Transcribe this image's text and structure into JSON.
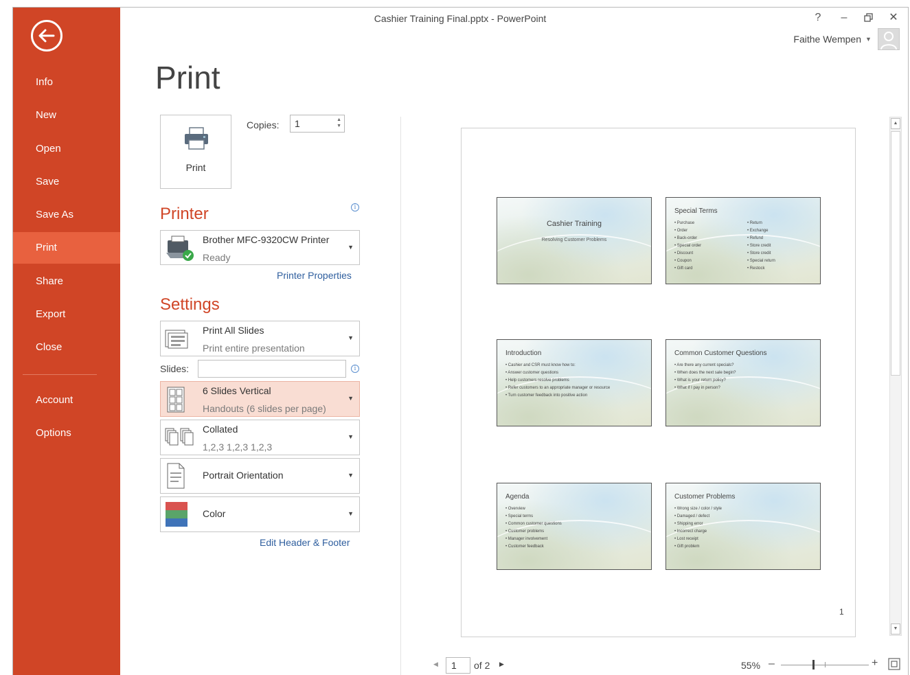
{
  "window": {
    "title": "Cashier Training Final.pptx - PowerPoint",
    "help_label": "?",
    "minimize_label": "–",
    "restore_label": "🗗",
    "close_label": "✕",
    "user_name": "Faithe Wempen"
  },
  "sidebar": {
    "back_icon": "back-arrow-icon",
    "items": [
      {
        "label": "Info"
      },
      {
        "label": "New"
      },
      {
        "label": "Open"
      },
      {
        "label": "Save"
      },
      {
        "label": "Save As"
      },
      {
        "label": "Print",
        "active": true
      },
      {
        "label": "Share"
      },
      {
        "label": "Export"
      },
      {
        "label": "Close"
      },
      {
        "label": "Account"
      },
      {
        "label": "Options"
      }
    ],
    "colors": {
      "background": "#d04526",
      "active": "#e8613f"
    }
  },
  "print_panel": {
    "page_title": "Print",
    "print_button_label": "Print",
    "copies_label": "Copies:",
    "copies_value": "1",
    "printer_heading": "Printer",
    "printer": {
      "name": "Brother MFC-9320CW Printer",
      "status": "Ready"
    },
    "printer_properties_link": "Printer Properties",
    "settings_heading": "Settings",
    "settings": {
      "slides_range": {
        "title": "Print All Slides",
        "subtitle": "Print entire presentation"
      },
      "slides_label": "Slides:",
      "slides_value": "",
      "layout": {
        "title": "6 Slides Vertical",
        "subtitle": "Handouts (6 slides per page)"
      },
      "collation": {
        "title": "Collated",
        "subtitle": "1,2,3   1,2,3   1,2,3"
      },
      "orientation": {
        "title": "Portrait Orientation"
      },
      "color": {
        "title": "Color"
      }
    },
    "edit_header_footer_link": "Edit Header & Footer",
    "accent_color": "#d04526"
  },
  "preview": {
    "page_number": "1",
    "slides": [
      {
        "title": "Cashier Training",
        "subtitle": "Resolving Customer Problems",
        "type": "title"
      },
      {
        "title": "Special Terms",
        "bullets_left": [
          "Purchase",
          "Order",
          "Back-order",
          "Special order",
          "Discount",
          "Coupon",
          "Gift card"
        ],
        "bullets_right": [
          "Return",
          "Exchange",
          "Refund",
          "Store credit",
          "Store credit",
          "Special return",
          "Restock"
        ]
      },
      {
        "title": "Introduction",
        "bullets": [
          "Cashier and CSR must know how to:",
          "Answer customer questions",
          "Help customers resolve problems",
          "Refer customers to an appropriate manager or resource",
          "Turn customer feedback into positive action"
        ]
      },
      {
        "title": "Common Customer Questions",
        "bullets": [
          "Are there any current specials?",
          "When does the next sale begin?",
          "What is your return policy?",
          "What if I pay in person?"
        ]
      },
      {
        "title": "Agenda",
        "bullets": [
          "Overview",
          "Special terms",
          "Common customer questions",
          "Customer problems",
          "Manager involvement",
          "Customer feedback"
        ]
      },
      {
        "title": "Customer Problems",
        "bullets": [
          "Wrong size / color / style",
          "Damaged / defect",
          "Shipping error",
          "Incorrect charge",
          "Lost receipt",
          "Gift problem"
        ]
      }
    ]
  },
  "navigation": {
    "current_page": "1",
    "page_of": "of 2",
    "zoom_level": "55%",
    "zoom_fraction": 0.55
  }
}
